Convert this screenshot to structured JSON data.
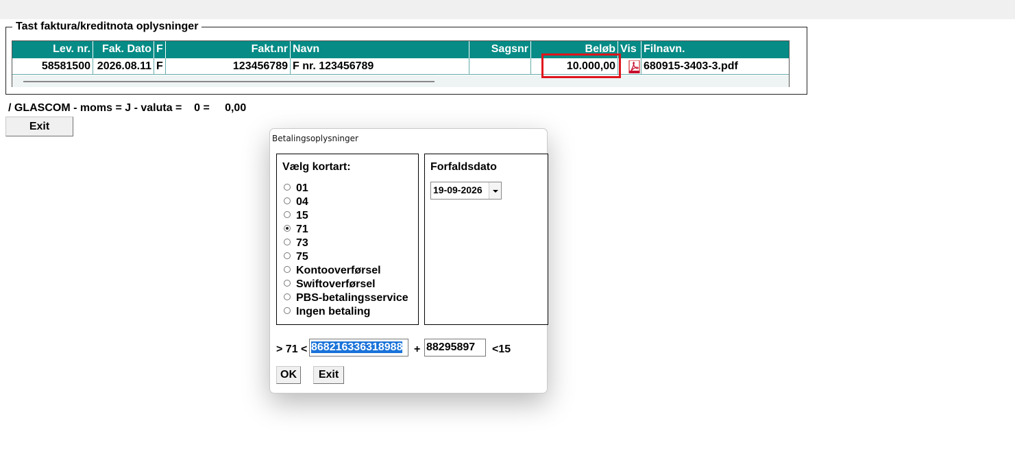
{
  "group": {
    "legend": "Tast faktura/kreditnota oplysninger"
  },
  "table": {
    "headers": [
      "Lev. nr.",
      "Fak. Dato",
      "F",
      "Fakt.nr",
      "Navn",
      "Sagsnr",
      "Beløb",
      "Vis",
      "Filnavn."
    ],
    "row": [
      "58581500",
      "2026.08.11",
      "F",
      "123456789",
      "F nr. 123456789",
      "",
      "10.000,00",
      "pdf-icon",
      "680915-3403-3.pdf"
    ]
  },
  "status": "/ GLASCOM - moms = J - valuta =    0 =     0,00",
  "main": {
    "exit_label": "Exit"
  },
  "dialog": {
    "title": "Betalingsoplysninger",
    "cards_title": "Vælg kortart:",
    "options": [
      "01",
      "04",
      "15",
      "71",
      "73",
      "75",
      "Kontooverførsel",
      "Swiftoverførsel",
      "PBS-betalingsservice",
      "Ingen betaling"
    ],
    "selected": "71",
    "due_title": "Forfaldsdato",
    "due_value": "19-09-2026",
    "prefix": "> 71 <",
    "payment_id": "868216336318988",
    "plus": "+",
    "creditor": "88295897",
    "suffix": "<15",
    "ok_label": "OK",
    "exit_label": "Exit"
  },
  "colors": {
    "header_bg": "#068b86",
    "highlight": "#e0141c",
    "selection": "#1a73d9"
  }
}
